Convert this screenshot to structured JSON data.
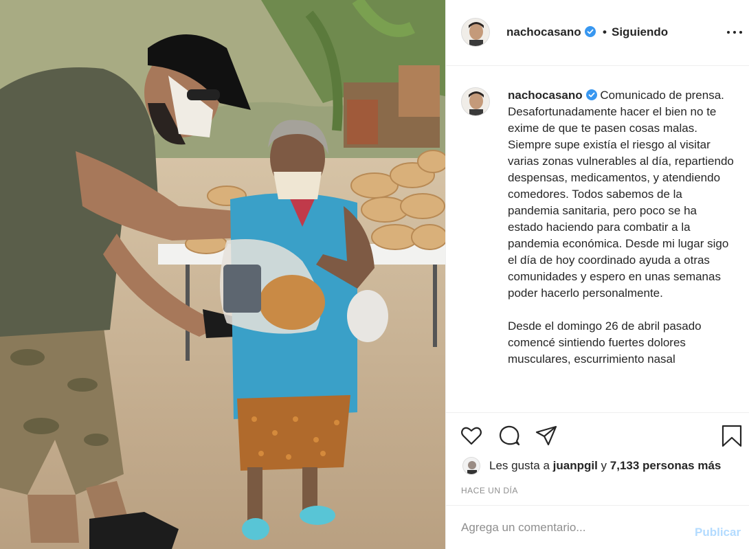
{
  "post": {
    "photo_alt": "",
    "author": {
      "username": "nachocasano",
      "verified": true,
      "follow_status": "Siguiendo"
    },
    "caption": {
      "username": "nachocasano",
      "paragraph1": "Comunicado de prensa. Desafortunadamente hacer el bien no te exime de que te pasen cosas malas. Siempre supe existía el riesgo al visitar varias zonas vulnerables al día, repartiendo despensas, medicamentos, y atendiendo comedores. Todos sabemos de la pandemia sanitaria, pero poco se ha estado haciendo para combatir a la pandemia económica. Desde mi lugar sigo el día de hoy coordinado ayuda a otras comunidades y espero en unas semanas poder hacerlo personalmente.",
      "paragraph2": "Desde el domingo 26 de abril pasado comencé sintiendo fuertes dolores musculares, escurrimiento nasal"
    },
    "likes": {
      "prefix": "Les gusta a",
      "user": "juanpgil",
      "connector": "y",
      "others": "7,133 personas más"
    },
    "timestamp": "HACE UN DÍA",
    "comment": {
      "placeholder": "Agrega un comentario...",
      "publish_label": "Publicar"
    }
  },
  "icons": {
    "like": "heart-icon",
    "comment": "comment-icon",
    "share": "share-icon",
    "save": "bookmark-icon",
    "more": "more-options-icon",
    "verified": "verified-badge-icon"
  },
  "colors": {
    "verified": "#3897f0",
    "publish_disabled": "#b3dbff",
    "muted": "#8e8e8e",
    "text": "#262626"
  }
}
